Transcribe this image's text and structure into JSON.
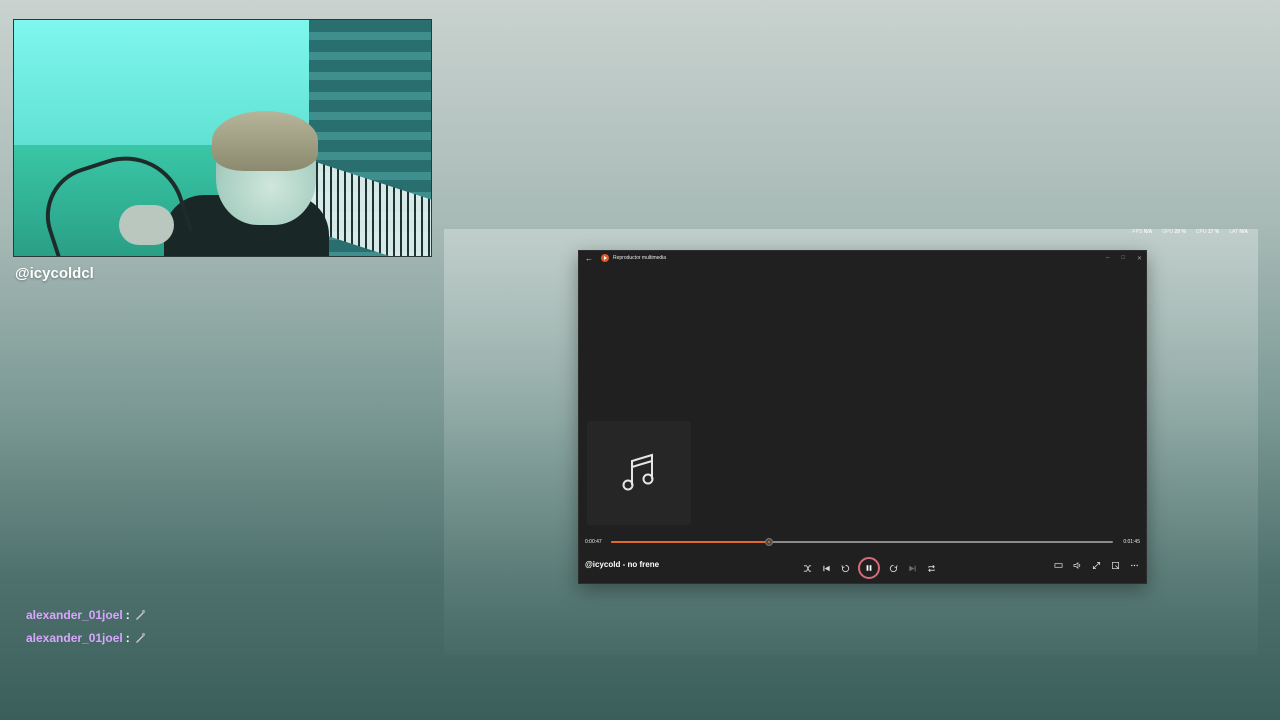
{
  "overlay": {
    "streamer_handle": "@icycoldcl",
    "chat": [
      {
        "user": "alexander_01joel",
        "separator": ":"
      },
      {
        "user": "alexander_01joel",
        "separator": ":"
      }
    ],
    "stats": [
      {
        "label": "FPS",
        "value": "N/A"
      },
      {
        "label": "GPU",
        "value": "20 %"
      },
      {
        "label": "CPU",
        "value": "17 %"
      },
      {
        "label": "LAT",
        "value": "N/A"
      }
    ]
  },
  "player": {
    "app_title": "Reproductor multimedia",
    "current_time": "0:00:47",
    "total_time": "0:01:45",
    "progress": 0.315,
    "track_title": "@icycold - no frene",
    "accent_color": "#e2692c",
    "icons": {
      "artwork": "music-note-icon",
      "transport": [
        "shuffle-icon",
        "previous-icon",
        "rewind-10-icon",
        "pause-icon",
        "forward-30-icon",
        "next-icon",
        "repeat-icon"
      ],
      "window_right": [
        "miniplayer-icon",
        "volume-icon",
        "fullscreen-icon",
        "cast-icon",
        "more-icon"
      ]
    }
  }
}
